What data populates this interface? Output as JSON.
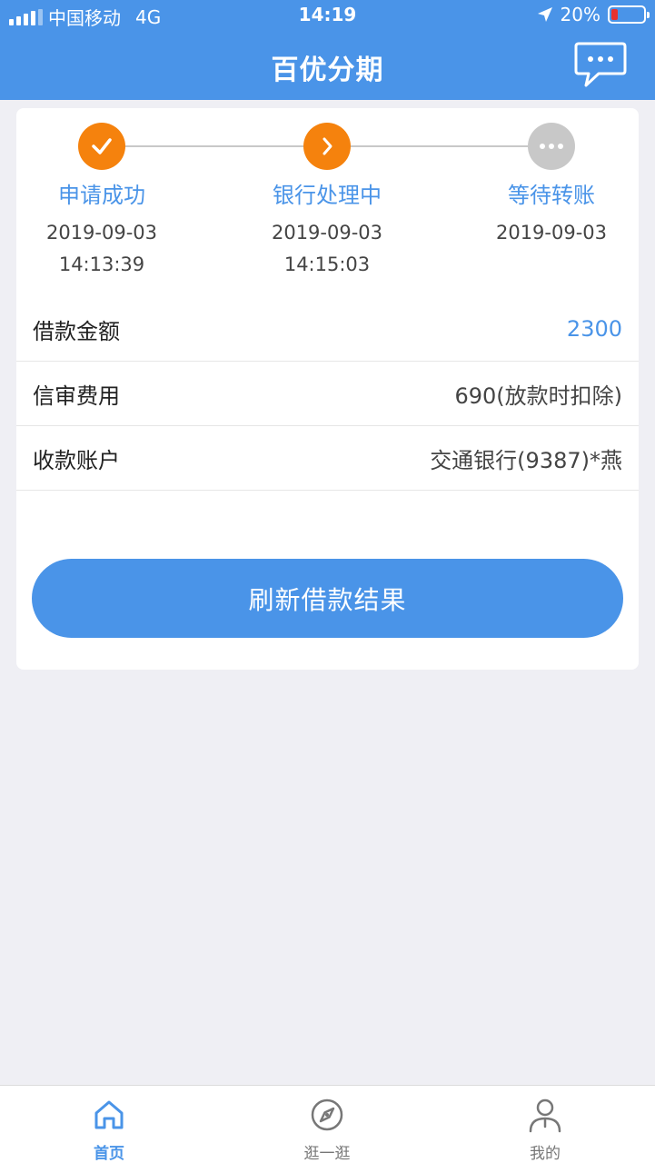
{
  "status_bar": {
    "carrier": "中国移动",
    "network": "4G",
    "time": "14:19",
    "battery_percent": "20%",
    "battery_level": 0.2
  },
  "nav": {
    "title": "百优分期",
    "message_icon": "chat-bubble-icon"
  },
  "steps": [
    {
      "label": "申请成功",
      "date": "2019-09-03",
      "time": "14:13:39",
      "status": "done",
      "icon": "check-icon",
      "color": "#f5820d"
    },
    {
      "label": "银行处理中",
      "date": "2019-09-03",
      "time": "14:15:03",
      "status": "current",
      "icon": "chevron-right-icon",
      "color": "#f5820d"
    },
    {
      "label": "等待转账",
      "date": "2019-09-03",
      "time": "",
      "status": "pending",
      "icon": "ellipsis-icon",
      "color": "#c8c8c8"
    }
  ],
  "details": [
    {
      "label": "借款金额",
      "value": "2300"
    },
    {
      "label": "信审费用",
      "value": "690(放款时扣除)"
    },
    {
      "label": "收款账户",
      "value": "交通银行(9387)*燕"
    }
  ],
  "refresh_button": "刷新借款结果",
  "tabs": [
    {
      "label": "首页",
      "icon": "home-icon",
      "active": true
    },
    {
      "label": "逛一逛",
      "icon": "compass-icon",
      "active": false
    },
    {
      "label": "我的",
      "icon": "user-icon",
      "active": false
    }
  ],
  "colors": {
    "primary": "#4a94e8",
    "accent": "#f5820d",
    "inactive": "#c8c8c8",
    "background": "#efeff4"
  }
}
